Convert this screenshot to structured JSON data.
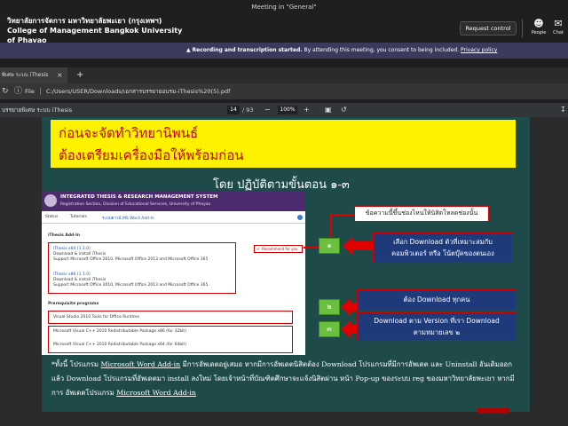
{
  "teams": {
    "meeting_title": "Meeting in \"General\"",
    "presenter_line1": "วิทยาลัยการจัดการ มหาวิทยาลัยพะเยา (กรุงเทพฯ)",
    "presenter_line2": "College of Management Bangkok University",
    "presenter_line3": "of Phayao",
    "request_control_label": "Request control",
    "people_label": "People",
    "chat_label": "Chat",
    "banner_bold": "Recording and transcription started.",
    "banner_text": "By attending this meeting, you consent to being included.",
    "banner_link": "Privacy policy"
  },
  "browser": {
    "tab_label": "พิเศษ ระบบ iThesis",
    "tab_close": "×",
    "new_tab": "+",
    "address_prefix": "File",
    "address": "C:/Users/USER/Downloads/เอกสารบรรยายอบรม-iThesis%20(5).pdf"
  },
  "pdf_toolbar": {
    "doc_name": "บรรยายพิเศษ ระบบ iThesis",
    "page_current": "14",
    "page_total": "/ 93",
    "zoom": "100%",
    "zoom_minus": "−",
    "zoom_plus": "+"
  },
  "slide": {
    "yellow_line1": "ก่อนจะจัดทำวิทยานิพนธ์",
    "yellow_line2": "ต้องเตรียมเครื่องมือให้พร้อมก่อน",
    "step_title": "โดย ปฏิบัติตามขั้นตอน ๑-๓",
    "callout_top": "ข้อความนี้ขึ้นช่องไหนให้นิสิตโหลดช่องนั้น",
    "badge1": "๑",
    "badge2": "๒",
    "badge3": "๓",
    "box1_line1": "เลือก Download ตัวที่เหมาะสมกับ",
    "box1_line2": "คอมพิวเตอร์ หรือ โน้ตบุ๊คของตนเอง",
    "box2": "ต้อง Download ทุกคน",
    "box3_line1": "Download ตาม Version ที่เรา Download",
    "box3_line2": "ตามหมายเลข ๒",
    "bottom_p1": "*ทั้งนี้ โปรแกรม",
    "bottom_u1": "Microsoft Word Add-in",
    "bottom_p2": " มีการอัพเดตอยู่เสมอ หากมีการอัพเดตนิสิตต้อง Download โปรแกรมที่มีการอัพเดต และ Uninstall อันเดิมออก แล้ว Download โปรแกรมที่อัพเดตมา install ลงใหม่ โดยเจ้าหน้าที่บัณฑิตศึกษาจะแจ้งนิสิตผ่าน หน้า Pop-up ของระบบ reg ของมหาวิทยาลัยพะเยา หากมีการ อัพเดตโปรแกรม ",
    "bottom_u2": "Microsoft Word Add-in"
  },
  "embedded": {
    "sys_title": "INTEGRATED THESIS & RESEARCH MANAGEMENT SYSTEM",
    "sys_sub": "Registration Section, Division of Educational Services, University of Phayao",
    "tab_status": "Status",
    "tab_tutorials": "Tutorials",
    "tab_addin": "ระบบดาวน์ MS Word Add-In",
    "section_addin": "iThesis Add-In",
    "x64_title": "iThesis x64 (1.1.0)",
    "x64_link": "Download & install iThesis",
    "x64_support": "Support Microsoft Office 2010, Microsoft Office 2013 and Microsoft Office 365",
    "recommended": "<- Recommend for you",
    "x86_title": "iThesis x86 (1.1.0)",
    "x86_link": "Download & install iThesis",
    "x86_support": "Support Microsoft Office 2010, Microsoft Office 2013 and Microsoft Office 365",
    "section_prereq": "Prerequisite programs",
    "prereq1": "Visual Studio 2010 Tools for Office Runtime",
    "prereq2": "Microsoft Visual C++ 2010 Redistributable Package x86 (for 32bit)",
    "prereq3": "Microsoft Visual C++ 2010 Redistributable Package x64 (for 64bit)"
  },
  "colors": {
    "slide_bg": "#1f4a4a",
    "yellow": "#fff200",
    "red": "#c00000",
    "blue_box": "#1e3a7a",
    "green_badge": "#6abf3f"
  }
}
